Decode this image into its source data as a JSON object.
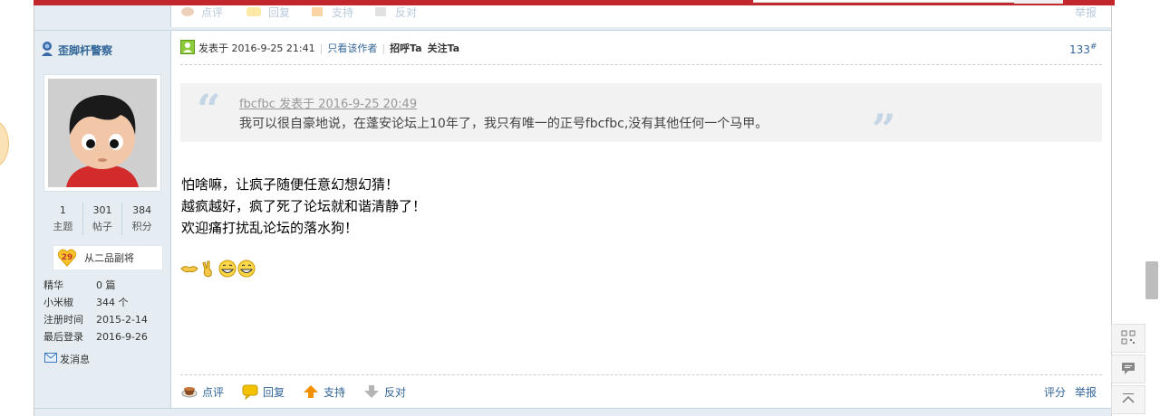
{
  "previous_post": {
    "actions": [
      "点评",
      "回复",
      "支持",
      "反对"
    ],
    "report": "举报"
  },
  "author": {
    "name": "歪脚杆警察",
    "stats": [
      {
        "value": "1",
        "label": "主题"
      },
      {
        "value": "301",
        "label": "帖子"
      },
      {
        "value": "384",
        "label": "积分"
      }
    ],
    "rank": {
      "level": "29",
      "title": "从二品副将"
    },
    "info": [
      {
        "key": "精华",
        "value": "0 篇"
      },
      {
        "key": "小米椒",
        "value": "344 个"
      },
      {
        "key": "注册时间",
        "value": "2015-2-14"
      },
      {
        "key": "最后登录",
        "value": "2016-9-26"
      }
    ],
    "send_message": "发消息"
  },
  "post": {
    "posted_at": "发表于 2016-9-25 21:41",
    "only_author": "只看该作者",
    "greet": "招呼Ta",
    "follow": "关注Ta",
    "floor": "133",
    "floor_mark": "#",
    "quote": {
      "meta": "fbcfbc 发表于 2016-9-25 20:49",
      "text": "我可以很自豪地说，在蓬安论坛上10年了，我只有唯一的正号fbcfbc,没有其他任何一个马甲。"
    },
    "body_lines": [
      "怕啥嘛，让疯子随便任意幻想幻猜！",
      "越疯越好，疯了死了论坛就和谐清静了！",
      "欢迎痛打扰乱论坛的落水狗！"
    ],
    "emojis": [
      "handshake-icon",
      "victory-hand-icon",
      "grin-icon",
      "grin-icon"
    ],
    "actions": {
      "comment": "点评",
      "reply": "回复",
      "support": "支持",
      "oppose": "反对",
      "rate": "评分",
      "report": "举报"
    }
  },
  "colors": {
    "topbar": "#c1272d",
    "link": "#336699",
    "sidebar": "#e5edf2"
  }
}
